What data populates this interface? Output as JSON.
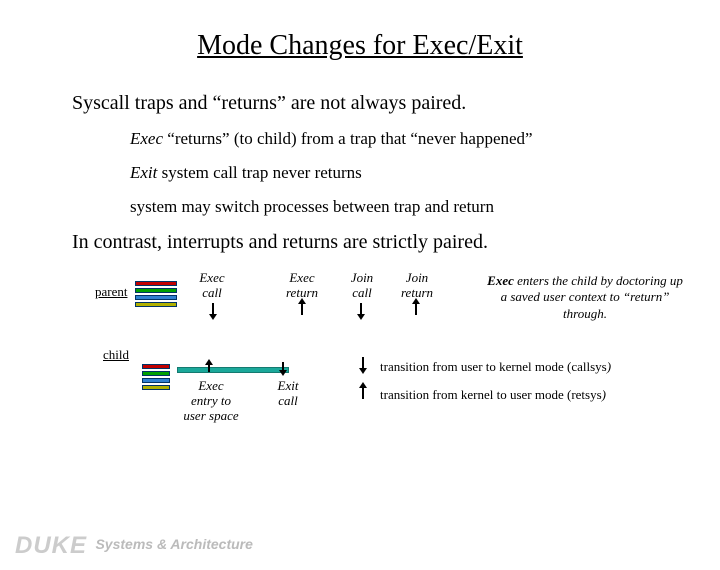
{
  "title": "Mode Changes for Exec/Exit",
  "line1": "Syscall traps and “returns” are not always paired.",
  "indent1_prefix": "Exec",
  "indent1_rest": " “returns” (to child) from a trap that “never happened”",
  "indent2_prefix": "Exit",
  "indent2_rest": " system call trap never returns",
  "indent3": "system may switch processes between trap and return",
  "line2": "In contrast, interrupts and returns are strictly paired.",
  "label_parent": "parent",
  "label_child": "child",
  "exec_call": "Exec\ncall",
  "exec_return": "Exec\nreturn",
  "join_call": "Join\ncall",
  "join_return": "Join\nreturn",
  "exec_entry": "Exec\nentry to\nuser space",
  "exit_call": "Exit\ncall",
  "side_note_prefix": "Exec",
  "side_note_rest": " enters the child by doctoring up a saved user context to “return” through.",
  "legend1": "transition from user to kernel mode (callsys",
  "legend2": "transition from kernel to user mode (retsys",
  "footer_duke": "DUKE",
  "footer_sys": "Systems & Architecture"
}
